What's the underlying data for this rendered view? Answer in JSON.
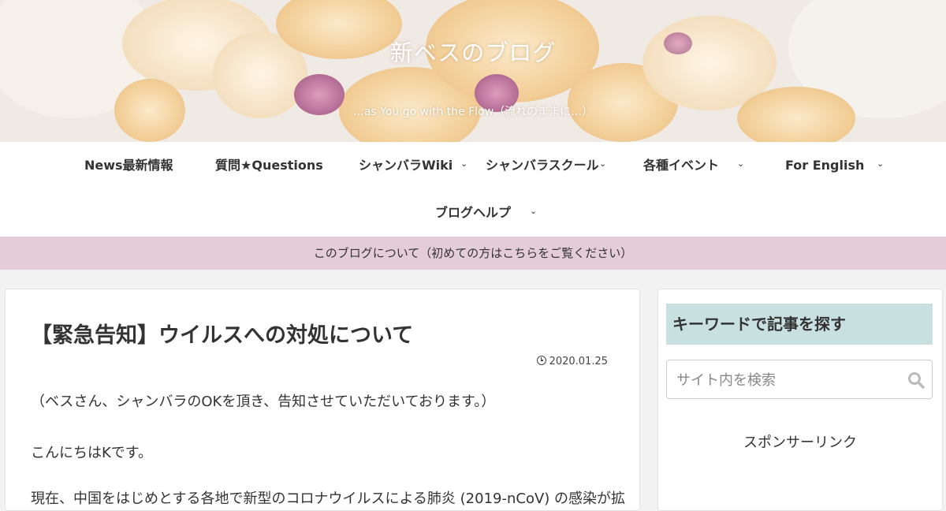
{
  "header": {
    "site_title": "新ベスのブログ",
    "tagline": "…as You go with the Flow（流れのままに…）"
  },
  "nav": {
    "items": [
      {
        "label": "News最新情報",
        "has_submenu": false
      },
      {
        "label": "質問★Questions",
        "has_submenu": false
      },
      {
        "label": "シャンバラWiki",
        "has_submenu": true
      },
      {
        "label": "シャンバラスクール",
        "has_submenu": true
      },
      {
        "label": "各種イベント",
        "has_submenu": true
      },
      {
        "label": "For English",
        "has_submenu": true
      },
      {
        "label": "ブログヘルプ",
        "has_submenu": true
      }
    ],
    "chevron_glyph": "⌄"
  },
  "notice": {
    "text": "このブログについて（初めての方はこちらをご覧ください）"
  },
  "article": {
    "title": "【緊急告知】ウイルスへの対処について",
    "date": "2020.01.25",
    "paragraphs": [
      "（ベスさん、シャンバラのOKを頂き、告知させていただいております。）",
      "こんにちはKです。",
      "現在、中国をはじめとする各地で新型のコロナウイルスによる肺炎 (2019-nCoV) の感染が拡"
    ]
  },
  "sidebar": {
    "search_heading": "キーワードで記事を探す",
    "search_placeholder": "サイト内を検索",
    "sponsor_label": "スポンサーリンク"
  },
  "colors": {
    "notice_bg": "#e4cdd8",
    "search_heading_bg": "#c8e0e0",
    "page_bg": "#f2f2f2"
  }
}
